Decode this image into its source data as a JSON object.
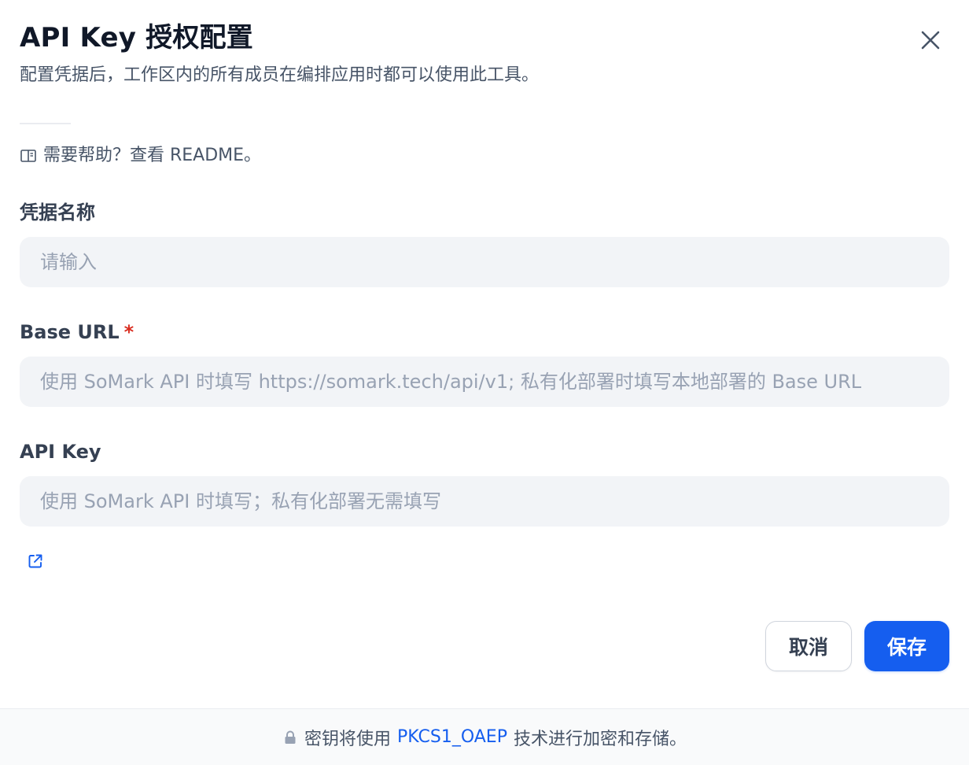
{
  "dialog": {
    "title": "API Key 授权配置",
    "subtitle": "配置凭据后，工作区内的所有成员在编排应用时都可以使用此工具。",
    "close_icon": "close-icon"
  },
  "help": {
    "icon": "book-icon",
    "text": "需要帮助？查看 README。"
  },
  "fields": {
    "credential_name": {
      "label": "凭据名称",
      "placeholder": "请输入",
      "value": ""
    },
    "base_url": {
      "label": "Base URL",
      "required_mark": "*",
      "placeholder": "使用 SoMark API 时填写 https://somark.tech/api/v1; 私有化部署时填写本地部署的 Base URL",
      "value": ""
    },
    "api_key": {
      "label": "API Key",
      "placeholder": "使用 SoMark API 时填写；私有化部署无需填写",
      "value": ""
    }
  },
  "external_link_icon": "external-link-icon",
  "actions": {
    "cancel_label": "取消",
    "save_label": "保存"
  },
  "footer": {
    "lock_icon": "lock-icon",
    "prefix": "密钥将使用",
    "algorithm": "PKCS1_OAEP",
    "suffix": "技术进行加密和存储。"
  },
  "colors": {
    "primary": "#155eef",
    "required": "#d92d20",
    "input_bg": "#f2f4f7"
  }
}
